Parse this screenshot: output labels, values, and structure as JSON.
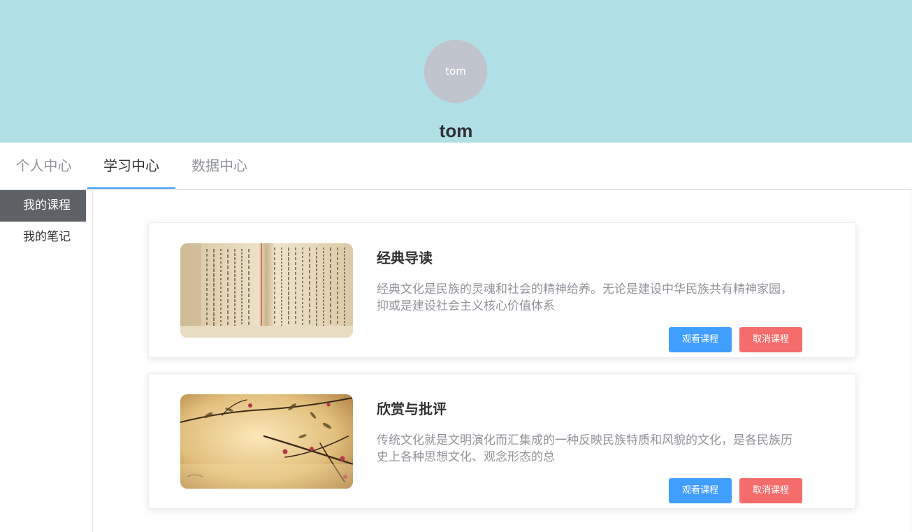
{
  "profile": {
    "avatar_text": "tom",
    "name": "tom"
  },
  "tabs": [
    {
      "label": "个人中心"
    },
    {
      "label": "学习中心"
    },
    {
      "label": "数据中心"
    }
  ],
  "sidebar": {
    "items": [
      {
        "label": "我的课程"
      },
      {
        "label": "我的笔记"
      }
    ]
  },
  "courses": [
    {
      "title": "经典导读",
      "description": "经典文化是民族的灵魂和社会的精神给养。无论是建设中华民族共有精神家园，抑或是建设社会主义核心价值体系",
      "watch_label": "观看课程",
      "cancel_label": "取消课程"
    },
    {
      "title": "欣赏与批评",
      "description": "传统文化就是文明演化而汇集成的一种反映民族特质和风貌的文化，是各民族历史上各种思想文化、观念形态的总",
      "watch_label": "观看课程",
      "cancel_label": "取消课程"
    }
  ],
  "colors": {
    "header_bg": "#b0dfe5",
    "primary": "#409eff",
    "danger": "#f56c6c",
    "sidebar_active": "#5e6166"
  }
}
